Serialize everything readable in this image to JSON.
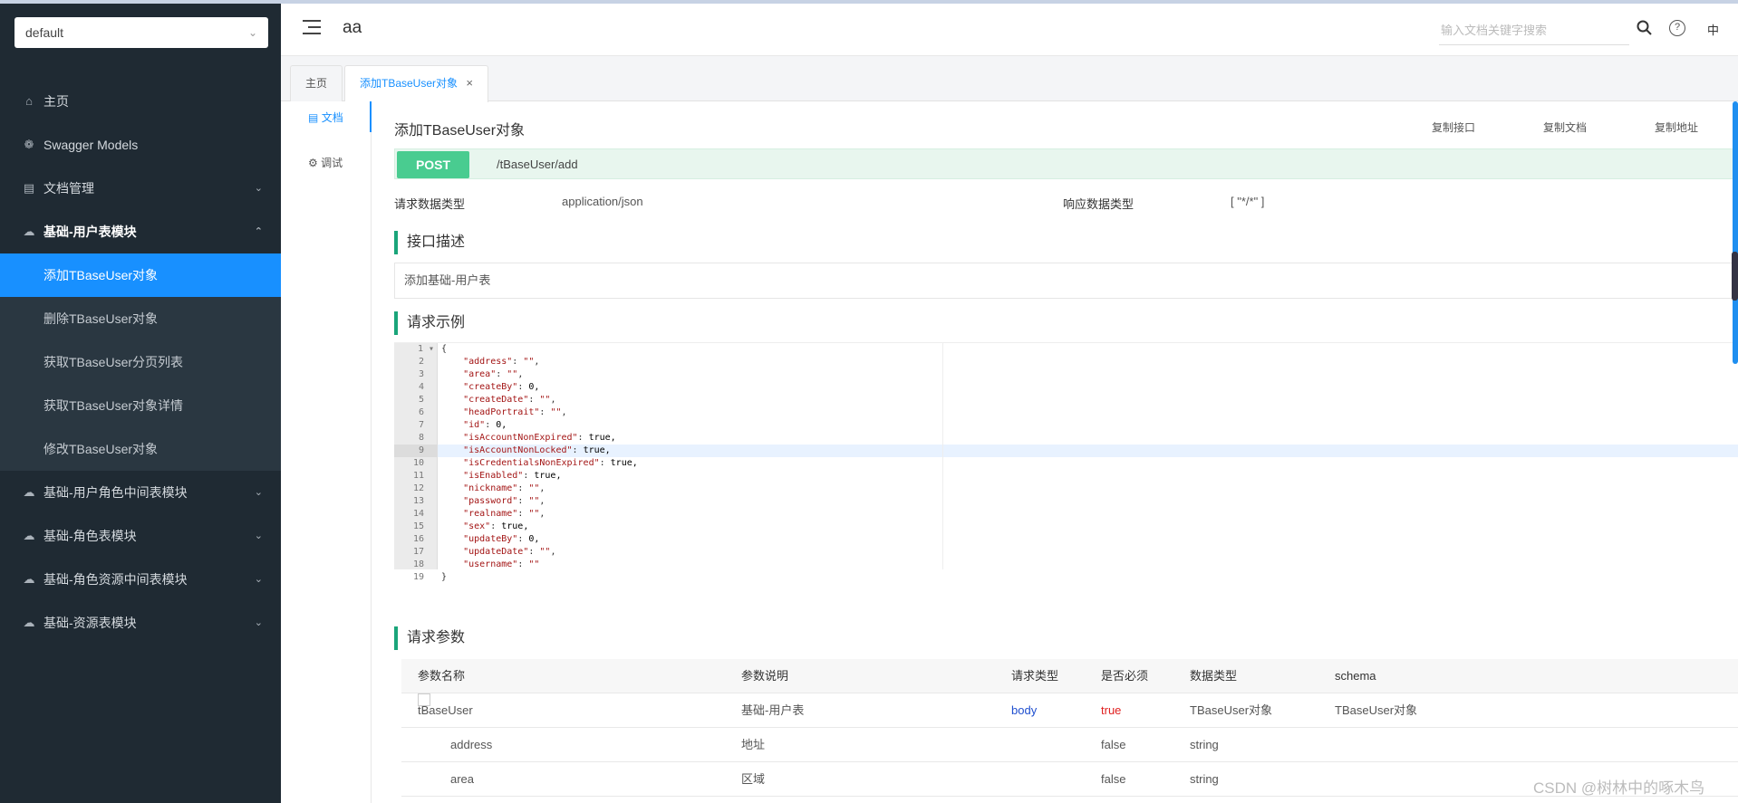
{
  "sidebar": {
    "group": "default",
    "items": [
      {
        "label": "主页",
        "icon": "home-icon"
      },
      {
        "label": "Swagger Models",
        "icon": "models-icon"
      },
      {
        "label": "文档管理",
        "icon": "docs-icon"
      },
      {
        "label": "基础-用户表模块",
        "icon": "cloud-icon"
      }
    ],
    "subitems": [
      "添加TBaseUser对象",
      "删除TBaseUser对象",
      "获取TBaseUser分页列表",
      "获取TBaseUser对象详情",
      "修改TBaseUser对象"
    ],
    "more_items": [
      "基础-用户角色中间表模块",
      "基础-角色表模块",
      "基础-角色资源中间表模块",
      "基础-资源表模块"
    ]
  },
  "header": {
    "title": "aa",
    "search_placeholder": "输入文档关键字搜索",
    "lang": "中"
  },
  "tabs": [
    {
      "label": "主页"
    },
    {
      "label": "添加TBaseUser对象"
    }
  ],
  "docnav": {
    "doc": "文档",
    "debug": "调试"
  },
  "api": {
    "title": "添加TBaseUser对象",
    "actions": [
      "复制接口",
      "复制文档",
      "复制地址"
    ],
    "method": "POST",
    "path": "/tBaseUser/add",
    "req_type_label": "请求数据类型",
    "req_type": "application/json",
    "resp_type_label": "响应数据类型",
    "resp_type": "[ \"*/*\" ]",
    "desc_heading": "接口描述",
    "desc": "添加基础-用户表",
    "example_heading": "请求示例",
    "params_heading": "请求参数"
  },
  "code_lines": [
    "{",
    "    \"address\": \"\",",
    "    \"area\": \"\",",
    "    \"createBy\": 0,",
    "    \"createDate\": \"\",",
    "    \"headPortrait\": \"\",",
    "    \"id\": 0,",
    "    \"isAccountNonExpired\": true,",
    "    \"isAccountNonLocked\": true,",
    "    \"isCredentialsNonExpired\": true,",
    "    \"isEnabled\": true,",
    "    \"nickname\": \"\",",
    "    \"password\": \"\",",
    "    \"realname\": \"\",",
    "    \"sex\": true,",
    "    \"updateBy\": 0,",
    "    \"updateDate\": \"\",",
    "    \"username\": \"\"",
    "}"
  ],
  "params": {
    "headers": [
      "参数名称",
      "参数说明",
      "请求类型",
      "是否必须",
      "数据类型",
      "schema"
    ],
    "rows": [
      {
        "name": "tBaseUser",
        "desc": "基础-用户表",
        "in": "body",
        "required": "true",
        "type": "TBaseUser对象",
        "schema": "TBaseUser对象"
      },
      {
        "name": "address",
        "desc": "地址",
        "in": "",
        "required": "false",
        "type": "string",
        "schema": ""
      },
      {
        "name": "area",
        "desc": "区域",
        "in": "",
        "required": "false",
        "type": "string",
        "schema": ""
      }
    ]
  },
  "watermark": "CSDN @树林中的啄木鸟"
}
